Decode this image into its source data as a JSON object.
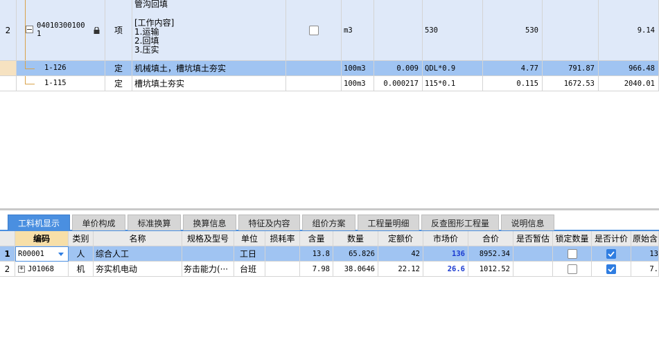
{
  "top_grid": {
    "rows": [
      {
        "index": "2",
        "code_line1": "04010300100",
        "code_line2": "1",
        "type": "项",
        "name_title": "管沟回填",
        "name_work_header": "[工作内容]",
        "name_work_items": [
          "1.运输",
          "2.回填",
          "3.压实"
        ],
        "unit": "m3",
        "qty_expr": "530",
        "qty": "530",
        "total": "9.14"
      },
      {
        "code": "1-126",
        "ellipsis": "···",
        "type": "定",
        "name": "机械填土，槽坑填土夯实",
        "unit": "100m3",
        "content": "0.009",
        "qty_expr": "QDL*0.9",
        "qty": "4.77",
        "unit_price": "791.87",
        "total": "966.48"
      },
      {
        "code": "1-115",
        "type": "定",
        "name": "槽坑填土夯实",
        "unit": "100m3",
        "content": "0.000217",
        "qty_expr": "115*0.1",
        "qty": "0.115",
        "unit_price": "1672.53",
        "total": "2040.01"
      }
    ]
  },
  "tabs": [
    "工料机显示",
    "单价构成",
    "标准换算",
    "换算信息",
    "特征及内容",
    "组价方案",
    "工程量明细",
    "反查图形工程量",
    "说明信息"
  ],
  "bottom_grid": {
    "headers": [
      "编码",
      "类别",
      "名称",
      "规格及型号",
      "单位",
      "损耗率",
      "含量",
      "数量",
      "定额价",
      "市场价",
      "合价",
      "是否暂估",
      "锁定数量",
      "是否计价",
      "原始含"
    ],
    "rows": [
      {
        "index": "1",
        "code": "R00001",
        "category": "人",
        "name": "综合人工",
        "spec": "",
        "unit": "工日",
        "loss": "",
        "content": "13.8",
        "qty": "65.826",
        "quota_price": "42",
        "market_price": "136",
        "total": "8952.34",
        "orig_content": "13"
      },
      {
        "index": "2",
        "code": "J01068",
        "expand": "+",
        "category": "机",
        "name": "夯实机电动",
        "spec": "夯击能力(···",
        "unit": "台班",
        "loss": "",
        "content": "7.98",
        "qty": "38.0646",
        "quota_price": "22.12",
        "market_price": "26.6",
        "total": "1012.52",
        "orig_content": "7."
      }
    ]
  },
  "colors": {
    "selected_row": "#a0c4f2",
    "main_row": "#dfe9f9",
    "active_tab": "#4a8fe0",
    "header_highlight": "#f7dfa8",
    "checked": "#2f7de1",
    "market_price_text": "#1a3ad0"
  }
}
